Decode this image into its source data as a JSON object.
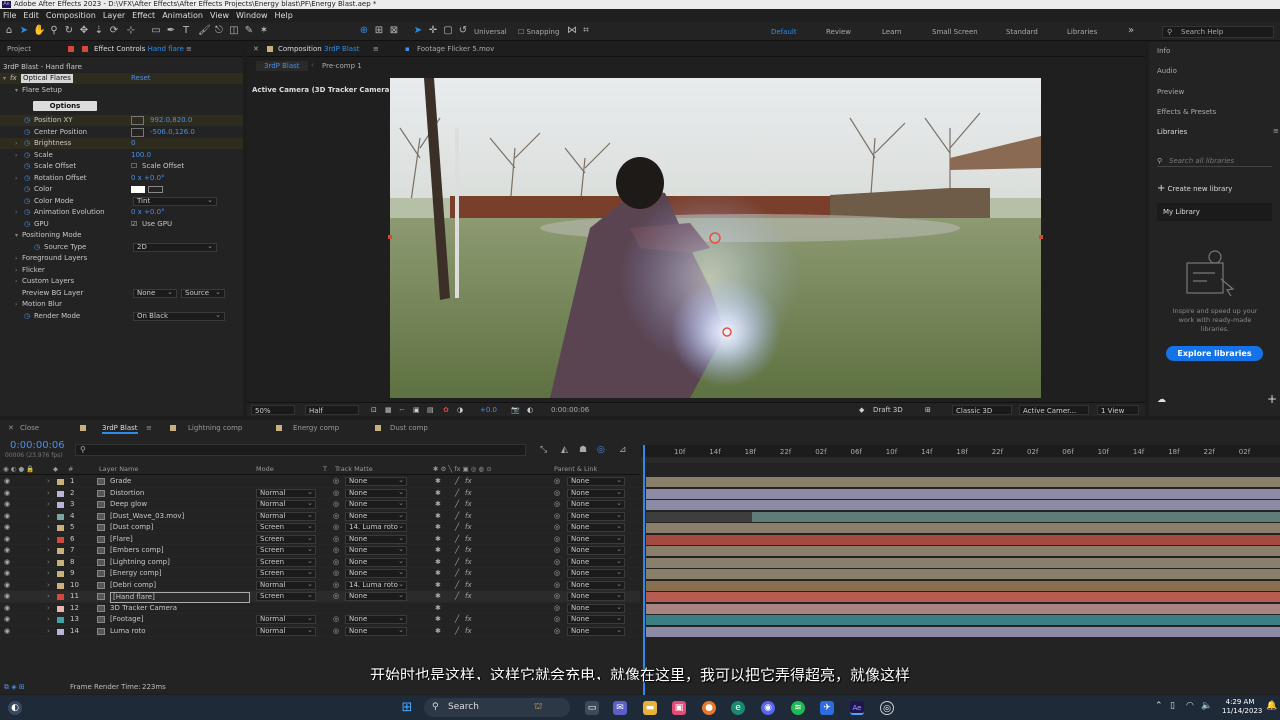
{
  "window": {
    "title": "Adobe After Effects 2023 - D:\\VFX\\After Effects\\After Effects Projects\\Energy blast\\PF\\Energy Blast.aep *",
    "app_icon": "Ae"
  },
  "menu": [
    "File",
    "Edit",
    "Composition",
    "Layer",
    "Effect",
    "Animation",
    "View",
    "Window",
    "Help"
  ],
  "toolbar": {
    "universal": "Universal",
    "snapping": "Snapping",
    "workspaces": [
      "Default",
      "Review",
      "Learn",
      "Small Screen",
      "Standard",
      "Libraries"
    ],
    "active_workspace": "Default",
    "search_help": "Search Help"
  },
  "left_panel": {
    "tab_project": "Project",
    "tab_effect_controls": "Effect Controls",
    "tab_effect_controls_layer": "Hand flare",
    "header": "3rdP Blast - Hand flare",
    "effect_name": "Optical Flares",
    "reset": "Reset",
    "flare_setup": "Flare Setup",
    "options_button": "Options",
    "props": [
      {
        "name": "Position XY",
        "value": "992.0,820.0"
      },
      {
        "name": "Center Position",
        "value": "-506.0,126.0"
      },
      {
        "name": "Brightness",
        "value": "0"
      },
      {
        "name": "Scale",
        "value": "100.0"
      },
      {
        "name": "Scale Offset",
        "value": "Scale Offset"
      },
      {
        "name": "Rotation Offset",
        "value": "0 x +0.0°"
      },
      {
        "name": "Color",
        "value": ""
      },
      {
        "name": "Color Mode",
        "value": "Tint"
      },
      {
        "name": "Animation Evolution",
        "value": "0 x +0.0°"
      },
      {
        "name": "GPU",
        "value": "Use GPU"
      }
    ],
    "positioning_mode": "Positioning Mode",
    "source_type": {
      "name": "Source Type",
      "value": "2D"
    },
    "foreground_layers": "Foreground Layers",
    "flicker": "Flicker",
    "custom_layers": "Custom Layers",
    "preview_bg_layer": {
      "name": "Preview BG Layer",
      "value": "None",
      "value2": "Source"
    },
    "motion_blur": "Motion Blur",
    "render_mode": {
      "name": "Render Mode",
      "value": "On Black"
    }
  },
  "comp_panel": {
    "tab_composition": "Composition",
    "tab_comp_name": "3rdP Blast",
    "tab_footage": "Footage Flicker 5.mov",
    "breadcrumb_active": "3rdP Blast",
    "breadcrumb_next": "Pre-comp 1",
    "camera_label": "Active Camera (3D Tracker Camera)",
    "bottom": {
      "zoom": "50%",
      "resolution": "Half",
      "exposure": "+0.0",
      "timecode": "0:00:00:06",
      "draft3d": "Draft 3D",
      "renderer": "Classic 3D",
      "camera": "Active Camer...",
      "views": "1 View"
    }
  },
  "right_panel": {
    "items": [
      "Info",
      "Audio",
      "Preview",
      "Effects & Presets",
      "Libraries"
    ],
    "search_placeholder": "Search all libraries",
    "create_library": "Create new library",
    "my_library": "My Library",
    "inspire_text": "Inspire and speed up your work with ready-made libraries.",
    "explore_button": "Explore libraries"
  },
  "timeline": {
    "tabs": [
      "Close",
      "3rdP Blast",
      "Lightning comp",
      "Energy comp",
      "Dust comp"
    ],
    "active_tab": "3rdP Blast",
    "timecode": "0:00:00:06",
    "timecode_sub": "00006 (23.976 fps)",
    "columns": {
      "layer_name": "Layer Name",
      "mode": "Mode",
      "t": "T",
      "track_matte": "Track Matte",
      "parent": "Parent & Link"
    },
    "ruler_ticks": [
      "10f",
      "14f",
      "18f",
      "22f",
      "02f",
      "06f",
      "10f",
      "14f",
      "18f",
      "22f",
      "02f",
      "06f",
      "10f",
      "14f",
      "18f",
      "22f",
      "02f"
    ],
    "layers": [
      {
        "num": "1",
        "name": "Grade",
        "mode": "",
        "matte": "None",
        "parent": "None",
        "label_color": "#c9b17a",
        "bar_color": "#8a7f6a"
      },
      {
        "num": "2",
        "name": "Distortion",
        "mode": "Normal",
        "matte": "None",
        "parent": "None",
        "label_color": "#b9b4d8",
        "bar_color": "#8c8aa5"
      },
      {
        "num": "3",
        "name": "Deep glow",
        "mode": "Normal",
        "matte": "None",
        "parent": "None",
        "label_color": "#b9b4d8",
        "bar_color": "#8c8aa5"
      },
      {
        "num": "4",
        "name": "[Dust_Wave_03.mov]",
        "mode": "Normal",
        "matte": "None",
        "parent": "None",
        "label_color": "#7aa8a0",
        "bar_color": "#5f7c78"
      },
      {
        "num": "5",
        "name": "[Dust comp]",
        "mode": "Screen",
        "matte": "14. Luma roto",
        "parent": "None",
        "label_color": "#c9b17a",
        "bar_color": "#8a7f6a"
      },
      {
        "num": "6",
        "name": "[Flare]",
        "mode": "Screen",
        "matte": "None",
        "parent": "None",
        "label_color": "#d4493c",
        "bar_color": "#a44a40"
      },
      {
        "num": "7",
        "name": "[Embers comp]",
        "mode": "Screen",
        "matte": "None",
        "parent": "None",
        "label_color": "#c9b17a",
        "bar_color": "#8a7f6a"
      },
      {
        "num": "8",
        "name": "[Lightning comp]",
        "mode": "Screen",
        "matte": "None",
        "parent": "None",
        "label_color": "#c9b17a",
        "bar_color": "#8a7f6a"
      },
      {
        "num": "9",
        "name": "[Energy comp]",
        "mode": "Screen",
        "matte": "None",
        "parent": "None",
        "label_color": "#c9b17a",
        "bar_color": "#8a7f6a"
      },
      {
        "num": "10",
        "name": "[Debri comp]",
        "mode": "Normal",
        "matte": "14. Luma roto",
        "parent": "None",
        "label_color": "#c9b17a",
        "bar_color": "#8a6e50"
      },
      {
        "num": "11",
        "name": "[Hand flare]",
        "mode": "Screen",
        "matte": "None",
        "parent": "None",
        "label_color": "#d4493c",
        "bar_color": "#b85c52"
      },
      {
        "num": "12",
        "name": "3D Tracker Camera",
        "mode": "",
        "matte": "",
        "parent": "None",
        "label_color": "#e8b5b0",
        "bar_color": "#a98582"
      },
      {
        "num": "13",
        "name": "[Footage]",
        "mode": "Normal",
        "matte": "None",
        "parent": "None",
        "label_color": "#3fa3a8",
        "bar_color": "#3b7f84"
      },
      {
        "num": "14",
        "name": "Luma roto",
        "mode": "Normal",
        "matte": "None",
        "parent": "None",
        "label_color": "#b9b4d8",
        "bar_color": "#8c8aa5"
      }
    ],
    "frame_render_time_label": "Frame Render Time:",
    "frame_render_time": "223ms"
  },
  "subtitle": "开始时也是这样，这样它就会充电，就像在这里，我可以把它弄得超亮，就像这样",
  "taskbar": {
    "search": "Search",
    "time": "4:29 AM",
    "date": "11/14/2023"
  }
}
